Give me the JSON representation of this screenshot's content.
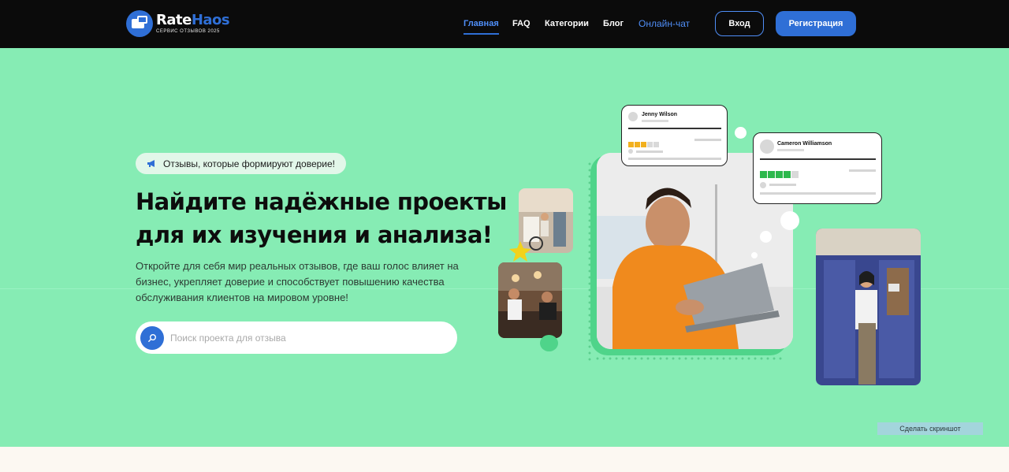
{
  "header": {
    "logo": {
      "name_part1": "Rate",
      "name_part2": "Haos",
      "tagline": "СЕРВИС ОТЗЫВОВ 2025"
    },
    "nav": [
      {
        "label": "Главная",
        "active": true
      },
      {
        "label": "FAQ",
        "active": false
      },
      {
        "label": "Категории",
        "active": false
      },
      {
        "label": "Блог",
        "active": false
      },
      {
        "label": "Онлайн-чат",
        "active": false
      }
    ],
    "login_label": "Вход",
    "register_label": "Регистрация"
  },
  "hero": {
    "badge": "Отзывы, которые формируют доверие!",
    "title_line1": "Найдите надёжные проекты",
    "title_line2": "для их изучения и анализа!",
    "desc_line1": "Откройте для себя мир реальных отзывов, где ваш голос влияет на",
    "desc_line2": "бизнес, укрепляет доверие и способствует повышению качества",
    "desc_line3": "обслуживания клиентов на мировом уровне!",
    "search_placeholder": "Поиск проекта для отзыва"
  },
  "review_cards": [
    {
      "name": "Jenny Wilson",
      "stars": 3,
      "star_color": "#f2b01e"
    },
    {
      "name": "Cameron Williamson",
      "stars": 4,
      "star_color": "#2db84d"
    }
  ],
  "screenshot_button": "Сделать скриншот",
  "colors": {
    "header_bg": "#0b0b0b",
    "accent": "#2f6fd6",
    "hero_bg": "#86ecb4",
    "page_bg": "#fcf8f2"
  }
}
